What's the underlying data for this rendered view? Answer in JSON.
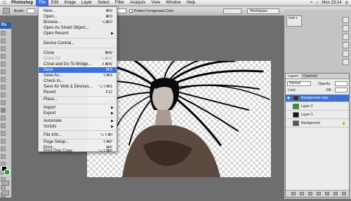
{
  "menubar": {
    "app": "Photoshop",
    "items": [
      "File",
      "Edit",
      "Image",
      "Layer",
      "Select",
      "Filter",
      "Analysis",
      "View",
      "Window",
      "Help"
    ],
    "time": "Mon 23:14"
  },
  "options": {
    "brush_label": "Brush:",
    "protect_label": "Protect Foreground Color",
    "workspace": "Workspace"
  },
  "file_menu": {
    "items": [
      {
        "label": "New...",
        "shortcut": "⌘N"
      },
      {
        "label": "Open...",
        "shortcut": "⌘O"
      },
      {
        "label": "Browse...",
        "shortcut": "⌥⌘O"
      },
      {
        "label": "Open As Smart Object...",
        "shortcut": ""
      },
      {
        "label": "Open Recent",
        "shortcut": ""
      },
      {
        "label": "Device Central...",
        "shortcut": ""
      },
      {
        "label": "Close",
        "shortcut": "⌘W"
      },
      {
        "label": "Close All",
        "shortcut": "⌥⌘W"
      },
      {
        "label": "Close and Go To Bridge...",
        "shortcut": "⇧⌘W"
      },
      {
        "label": "Save",
        "shortcut": "⌘S"
      },
      {
        "label": "Save As...",
        "shortcut": "⇧⌘S"
      },
      {
        "label": "Check In...",
        "shortcut": ""
      },
      {
        "label": "Save for Web & Devices...",
        "shortcut": "⌥⇧⌘S"
      },
      {
        "label": "Revert",
        "shortcut": "F12"
      },
      {
        "label": "Place...",
        "shortcut": ""
      },
      {
        "label": "Import",
        "shortcut": ""
      },
      {
        "label": "Export",
        "shortcut": ""
      },
      {
        "label": "Automate",
        "shortcut": ""
      },
      {
        "label": "Scripts",
        "shortcut": ""
      },
      {
        "label": "File Info...",
        "shortcut": "⌥⇧⌘I"
      },
      {
        "label": "Page Setup...",
        "shortcut": "⇧⌘P"
      },
      {
        "label": "Print...",
        "shortcut": "⌘P"
      },
      {
        "label": "Print One Copy",
        "shortcut": "⌥⇧⌘P"
      }
    ]
  },
  "layers_panel": {
    "tabs": [
      "Layers",
      "Channels"
    ],
    "blend_mode": "Normal",
    "opacity_label": "Opacity:",
    "lock_label": "Lock:",
    "fill_label": "Fill:",
    "layers": [
      {
        "name": "Background copy",
        "selected": true
      },
      {
        "name": "Layer 2",
        "selected": false
      },
      {
        "name": "Layer 1",
        "selected": false
      },
      {
        "name": "Background",
        "selected": false
      }
    ]
  },
  "paths_panel": {
    "item": "Path 1"
  },
  "toolbox": {
    "label": "Ps"
  },
  "colors": {
    "accent": "#3b72db",
    "layer2": "#22a022",
    "layer1": "#141414"
  }
}
